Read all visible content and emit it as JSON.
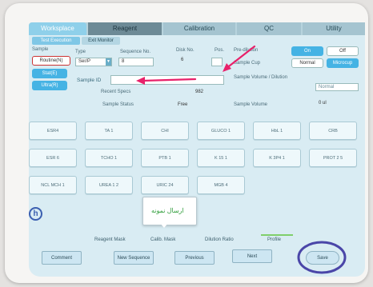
{
  "tabs": [
    {
      "label": "Worksplace",
      "active": true
    },
    {
      "label": "Reagent",
      "active": false
    },
    {
      "label": "Calibration",
      "active": false
    },
    {
      "label": "QC",
      "active": false
    },
    {
      "label": "Utility",
      "active": false
    }
  ],
  "subtabs": [
    "Test Execution",
    "Exit Monitor"
  ],
  "sample": {
    "section_label": "Sample",
    "routine_value": "Routine(N)",
    "stat_button": "Stat(E)",
    "ultra_button": "Ultra(R)",
    "type_label": "Type",
    "type_value": "Ser/P",
    "sequence_label": "Sequence No.",
    "sequence_value": "8",
    "disk_label": "Disk No.",
    "disk_value": "6",
    "pos_label": "Pos.",
    "pos_value": "",
    "prediluton_label": "Pre-dilution",
    "on_label": "On",
    "off_label": "Off",
    "sample_cup_label": "Sample Cup",
    "normal_label": "Normal",
    "microcup_label": "Microcup",
    "sample_id_label": "Sample ID",
    "sample_id_value": "",
    "sample_volume_dilution_label": "Sample Volume / Dilution",
    "volume_select": "Normal",
    "recent_specs_label": "Recent Specs",
    "recent_specs_value": "982",
    "sample_status_label": "Sample Status",
    "sample_status_value": "Free",
    "sample_volume_label": "Sample Volume",
    "sample_volume_value": "0 ul"
  },
  "tests": [
    "ESR4",
    "TA 1",
    "CHI",
    "GLUCO 1",
    "HbL 1",
    "CRB",
    "ESR 6",
    "TCHO 1",
    "PTB 1",
    "K 15 1",
    "K 3P4 1",
    "PROT 2 5",
    "NCL MCH 1",
    "UREA 1 2",
    "URIC 24",
    "MGB 4"
  ],
  "help_glyph": "h",
  "tooltip_text": "ارسال نمونه",
  "legend": {
    "reagent_mask": "Reagent Mask",
    "calib_mask": "Calib. Mask",
    "dilution_ratio": "Dilution Ratio",
    "profile": "Profile"
  },
  "footer": {
    "comment": "Comment",
    "new_sequence": "New Sequence",
    "previous": "Previous",
    "next": "Next",
    "save": "Save"
  },
  "colors": {
    "screen_bg": "#d9ecf3",
    "tab_active": "#8fd0ea",
    "button_blue": "#45b3e4",
    "arrow": "#e8216a",
    "save_circle": "#4a46a8"
  }
}
